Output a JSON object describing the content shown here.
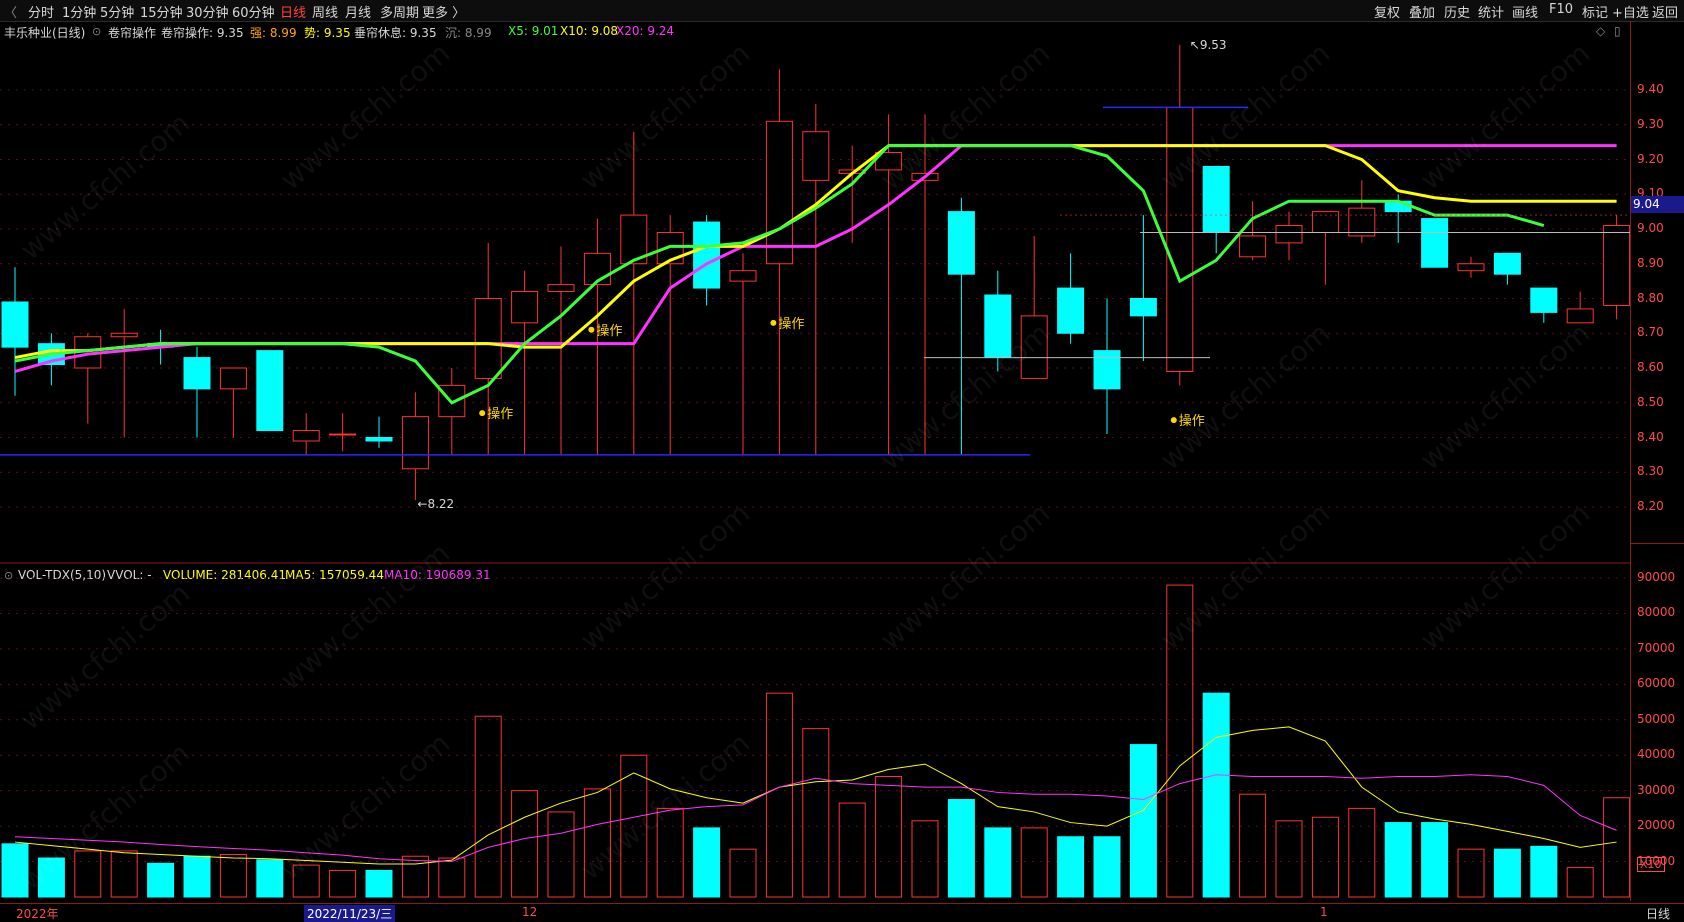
{
  "toolbar": {
    "left": [
      "分时",
      "1分钟",
      "5分钟",
      "15分钟",
      "30分钟",
      "60分钟",
      "日线",
      "周线",
      "月线",
      "多周期",
      "更多 〉"
    ],
    "active": "日线",
    "right": [
      "复权",
      "叠加",
      "历史",
      "统计",
      "画线",
      "F10",
      "标记",
      "+自选",
      "返回"
    ]
  },
  "price_header": {
    "name": "丰乐种业(日线)",
    "indicator": "卷帘操作",
    "items": [
      {
        "text": "卷帘操作: 9.35",
        "color": "#d8d8d8"
      },
      {
        "text": "强: 8.99",
        "color": "#ffa500"
      },
      {
        "text": "势: 9.35",
        "color": "#ffff00"
      },
      {
        "text": "垂帘休息: 9.35",
        "color": "#d8d8d8"
      },
      {
        "text": "沉: 8.99",
        "color": "#888888"
      },
      {
        "text": "X5: 9.01",
        "color": "#3cff3c"
      },
      {
        "text": "X10: 9.08",
        "color": "#ffff00"
      },
      {
        "text": "X20: 9.24",
        "color": "#ff33ff"
      }
    ]
  },
  "vol_header": {
    "name": "VOL-TDX(5,10)",
    "items": [
      {
        "text": "VVOL: -",
        "color": "#d8d8d8"
      },
      {
        "text": "VOLUME: 281406.41",
        "color": "#ffff00"
      },
      {
        "text": "MA5: 157059.44",
        "color": "#ffff00"
      },
      {
        "text": "MA10: 190689.31",
        "color": "#ff33ff"
      }
    ]
  },
  "price_axis": [
    "9.40",
    "9.30",
    "9.20",
    "9.10",
    "9.00",
    "8.90",
    "8.80",
    "8.70",
    "8.60",
    "8.50",
    "8.40",
    "8.30",
    "8.20"
  ],
  "vol_axis": [
    "90000",
    "80000",
    "70000",
    "60000",
    "50000",
    "40000",
    "30000",
    "20000",
    "10000"
  ],
  "current_price": "9.04",
  "high_label": "9.53",
  "low_label": "8.22",
  "op_label": "操作",
  "vol_unit": "X10",
  "dates": {
    "left": "2022年",
    "cursor": "2022/11/23/三",
    "m12": "12",
    "m1": "1"
  },
  "period_label": "日线",
  "watermark": "www.cfchi.com",
  "colors": {
    "up": "#ff3232",
    "down": "#00ffff",
    "x5": "#3cff3c",
    "x10": "#ffff00",
    "x20": "#ff33ff",
    "ma5": "#ffff00",
    "ma10": "#ff33ff"
  },
  "chart_data": {
    "type": "candlestick",
    "candles": [
      [
        8.66,
        8.79,
        8.89,
        8.52,
        "d"
      ],
      [
        8.61,
        8.67,
        8.7,
        8.55,
        "d"
      ],
      [
        8.6,
        8.69,
        8.7,
        8.44,
        "u"
      ],
      [
        8.69,
        8.7,
        8.77,
        8.4,
        "u"
      ],
      [
        8.66,
        8.67,
        8.71,
        8.61,
        "d"
      ],
      [
        8.54,
        8.63,
        8.66,
        8.4,
        "d"
      ],
      [
        8.54,
        8.6,
        8.6,
        8.4,
        "u"
      ],
      [
        8.42,
        8.65,
        8.65,
        8.42,
        "d"
      ],
      [
        8.39,
        8.42,
        8.47,
        8.35,
        "u"
      ],
      [
        8.41,
        8.41,
        8.47,
        8.36,
        "u"
      ],
      [
        8.39,
        8.4,
        8.46,
        8.37,
        "d"
      ],
      [
        8.31,
        8.46,
        8.53,
        8.22,
        "u"
      ],
      [
        8.46,
        8.55,
        8.6,
        8.35,
        "u"
      ],
      [
        8.57,
        8.8,
        8.96,
        8.35,
        "u"
      ],
      [
        8.73,
        8.82,
        8.88,
        8.35,
        "u"
      ],
      [
        8.82,
        8.84,
        8.95,
        8.35,
        "u"
      ],
      [
        8.84,
        8.93,
        9.03,
        8.35,
        "u"
      ],
      [
        8.9,
        9.04,
        9.28,
        8.35,
        "u"
      ],
      [
        8.9,
        8.99,
        9.04,
        8.35,
        "u"
      ],
      [
        8.83,
        9.02,
        9.04,
        8.78,
        "d"
      ],
      [
        8.85,
        8.88,
        8.93,
        8.35,
        "u"
      ],
      [
        8.9,
        9.31,
        9.46,
        8.35,
        "u"
      ],
      [
        9.14,
        9.28,
        9.36,
        8.35,
        "u"
      ],
      [
        9.16,
        9.17,
        9.24,
        8.96,
        "u"
      ],
      [
        9.17,
        9.22,
        9.33,
        8.35,
        "u"
      ],
      [
        9.14,
        9.16,
        9.33,
        8.35,
        "u"
      ],
      [
        8.87,
        9.05,
        9.09,
        8.35,
        "d"
      ],
      [
        8.63,
        8.81,
        8.88,
        8.59,
        "d"
      ],
      [
        8.57,
        8.75,
        8.98,
        8.57,
        "u"
      ],
      [
        8.7,
        8.83,
        8.93,
        8.67,
        "d"
      ],
      [
        8.54,
        8.65,
        8.8,
        8.41,
        "d"
      ],
      [
        8.75,
        8.8,
        9.04,
        8.62,
        "d"
      ],
      [
        8.59,
        9.35,
        9.53,
        8.55,
        "u"
      ],
      [
        8.99,
        9.18,
        9.18,
        8.93,
        "d"
      ],
      [
        8.92,
        8.98,
        9.08,
        8.91,
        "u"
      ],
      [
        8.96,
        9.01,
        9.05,
        8.91,
        "u"
      ],
      [
        8.99,
        9.05,
        9.05,
        8.84,
        "u"
      ],
      [
        8.98,
        9.06,
        9.14,
        8.96,
        "u"
      ],
      [
        9.05,
        9.08,
        9.1,
        8.96,
        "d"
      ],
      [
        8.89,
        9.03,
        9.03,
        8.89,
        "d"
      ],
      [
        8.88,
        8.9,
        8.92,
        8.86,
        "u"
      ],
      [
        8.87,
        8.93,
        8.93,
        8.84,
        "d"
      ],
      [
        8.76,
        8.83,
        8.83,
        8.73,
        "d"
      ],
      [
        8.73,
        8.77,
        8.82,
        8.73,
        "u"
      ],
      [
        8.78,
        9.01,
        9.04,
        8.74,
        "u"
      ]
    ],
    "x5": [
      8.62,
      8.64,
      8.65,
      8.66,
      8.67,
      8.67,
      8.67,
      8.67,
      8.67,
      8.67,
      8.66,
      8.62,
      8.5,
      8.55,
      8.67,
      8.75,
      8.85,
      8.91,
      8.95,
      8.95,
      8.96,
      9.0,
      9.06,
      9.13,
      9.24,
      9.24,
      9.24,
      9.24,
      9.24,
      9.24,
      9.21,
      9.11,
      8.85,
      8.91,
      9.03,
      9.08,
      9.08,
      9.08,
      9.08,
      9.04,
      9.04,
      9.04,
      9.01
    ],
    "x10": [
      8.63,
      8.65,
      8.65,
      8.66,
      8.67,
      8.67,
      8.67,
      8.67,
      8.67,
      8.67,
      8.67,
      8.67,
      8.67,
      8.67,
      8.66,
      8.66,
      8.75,
      8.85,
      8.91,
      8.95,
      8.95,
      9.0,
      9.07,
      9.16,
      9.24,
      9.24,
      9.24,
      9.24,
      9.24,
      9.24,
      9.24,
      9.24,
      9.24,
      9.24,
      9.24,
      9.24,
      9.24,
      9.2,
      9.11,
      9.09,
      9.08,
      9.08,
      9.08,
      9.08,
      9.08
    ],
    "x20": [
      8.59,
      8.62,
      8.64,
      8.65,
      8.66,
      8.67,
      8.67,
      8.67,
      8.67,
      8.67,
      8.67,
      8.67,
      8.67,
      8.67,
      8.67,
      8.67,
      8.67,
      8.67,
      8.83,
      8.9,
      8.95,
      8.95,
      8.95,
      9.0,
      9.07,
      9.15,
      9.24,
      9.24,
      9.24,
      9.24,
      9.24,
      9.24,
      9.24,
      9.24,
      9.24,
      9.24,
      9.24,
      9.24,
      9.24,
      9.24,
      9.24,
      9.24,
      9.24,
      9.24,
      9.24
    ],
    "volume": [
      15000,
      11000,
      13000,
      13000,
      9500,
      11500,
      12000,
      10500,
      9000,
      7500,
      7500,
      11500,
      11000,
      51000,
      30000,
      24000,
      30500,
      40000,
      25000,
      19500,
      13500,
      57500,
      47500,
      26500,
      34000,
      21500,
      27500,
      19500,
      19500,
      17000,
      17000,
      43000,
      88000,
      57500,
      29000,
      21500,
      22500,
      25000,
      21000,
      21000,
      13500,
      13500,
      14300,
      8300,
      28000
    ],
    "vol_ma5": [
      15500,
      14500,
      13500,
      12500,
      12000,
      11500,
      11000,
      10800,
      10300,
      9800,
      9300,
      9300,
      10400,
      17500,
      22500,
      26500,
      29500,
      35000,
      30500,
      28000,
      26500,
      31000,
      32500,
      33000,
      36000,
      37500,
      32000,
      25500,
      24000,
      21000,
      20000,
      24500,
      37000,
      45000,
      47000,
      48000,
      44000,
      31000,
      24000,
      22000,
      20500,
      18500,
      16500,
      14000,
      15500
    ],
    "vol_ma10": [
      17000,
      16500,
      16000,
      15500,
      14800,
      14200,
      13700,
      13200,
      12500,
      11800,
      10800,
      10300,
      10000,
      14000,
      16500,
      18000,
      20500,
      22500,
      24500,
      25500,
      26000,
      31000,
      33500,
      32000,
      31500,
      31000,
      31000,
      29500,
      29000,
      29000,
      28500,
      27500,
      32000,
      34500,
      34000,
      34000,
      34000,
      33500,
      34000,
      34000,
      34500,
      34000,
      31500,
      23000,
      18800
    ],
    "op_markers": [
      13,
      16,
      21,
      32
    ]
  }
}
